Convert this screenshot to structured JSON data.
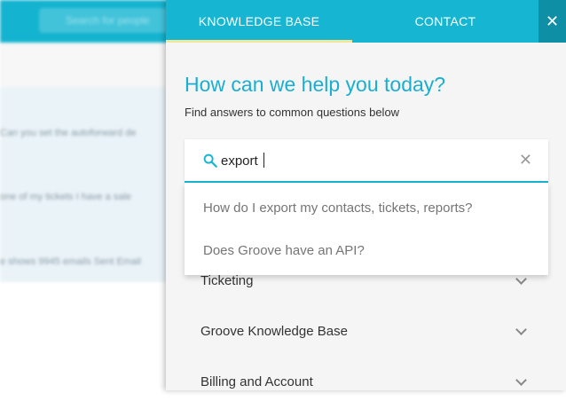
{
  "background": {
    "search_placeholder": "Search for people",
    "rows": [
      "Can you set the autoforward de",
      "one of my tickets I have a sale",
      "e shows 9945 emails  Sent Email"
    ]
  },
  "panel": {
    "tabs": [
      {
        "label": "KNOWLEDGE BASE",
        "active": true
      },
      {
        "label": "CONTACT",
        "active": false
      }
    ],
    "close_label": "✕",
    "headline": "How can we help you today?",
    "subheadline": "Find answers to common questions below",
    "search": {
      "value": "export",
      "clear_label": "✕"
    },
    "suggestions": [
      "How do I export my contacts, tickets, reports?",
      "Does Groove have an API?"
    ],
    "categories": [
      "Ticketing",
      "Groove Knowledge Base",
      "Billing and Account"
    ],
    "colors": {
      "accent": "#16b6d2",
      "headline": "#1aaed0",
      "tab_underline": "#f3e59a",
      "close_bg": "#0f8fa6"
    }
  }
}
